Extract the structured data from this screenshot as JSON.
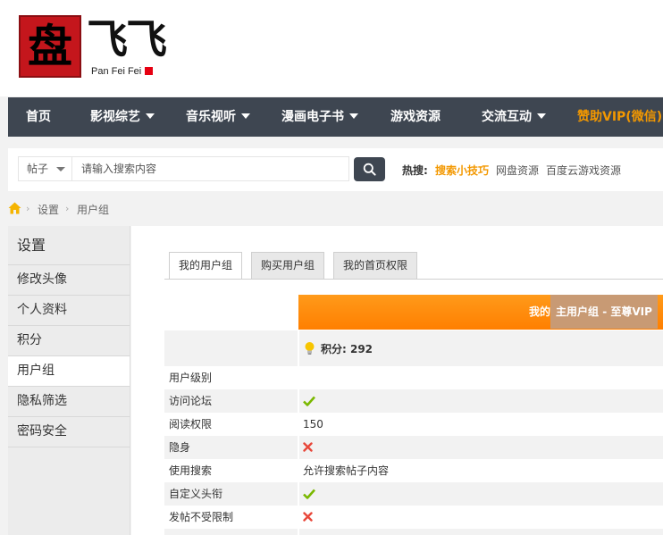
{
  "header": {
    "logo_char": "盘",
    "logo_brush": "飞飞",
    "logo_sub": "Pan Fei Fei"
  },
  "nav": {
    "items": [
      {
        "label": "首页",
        "has_dropdown": false
      },
      {
        "label": "影视综艺",
        "has_dropdown": true
      },
      {
        "label": "音乐视听",
        "has_dropdown": true
      },
      {
        "label": "漫画电子书",
        "has_dropdown": true
      },
      {
        "label": "游戏资源",
        "has_dropdown": false
      },
      {
        "label": "交流互动",
        "has_dropdown": true
      },
      {
        "label": "赞助VIP(微信)",
        "has_dropdown": false,
        "color": "#f39800"
      }
    ]
  },
  "search": {
    "type_selected": "帖子",
    "placeholder": "请输入搜索内容",
    "hot_label": "热搜:",
    "hot_links": [
      "搜索小技巧",
      "网盘资源",
      "百度云游戏资源"
    ]
  },
  "breadcrumb": {
    "items": [
      "设置",
      "用户组"
    ]
  },
  "sidebar": {
    "title": "设置",
    "items": [
      {
        "label": "修改头像",
        "active": false
      },
      {
        "label": "个人资料",
        "active": false
      },
      {
        "label": "积分",
        "active": false
      },
      {
        "label": "用户组",
        "active": true
      },
      {
        "label": "隐私筛选",
        "active": false
      },
      {
        "label": "密码安全",
        "active": false
      }
    ]
  },
  "tabs": [
    {
      "label": "我的用户组",
      "active": true
    },
    {
      "label": "购买用户组",
      "active": false
    },
    {
      "label": "我的首页权限",
      "active": false
    }
  ],
  "group": {
    "title_prefix": "我的",
    "title_current": "主用户组 - 至尊VIP",
    "points_text": "积分: 292"
  },
  "permissions": [
    {
      "label": "用户级别",
      "value": "",
      "status": "none"
    },
    {
      "label": "访问论坛",
      "value": "",
      "status": "yes"
    },
    {
      "label": "阅读权限",
      "value": "150",
      "status": "text"
    },
    {
      "label": "隐身",
      "value": "",
      "status": "no"
    },
    {
      "label": "使用搜索",
      "value": "允许搜索帖子内容",
      "status": "text"
    },
    {
      "label": "自定义头衔",
      "value": "",
      "status": "yes"
    },
    {
      "label": "发帖不受限制",
      "value": "",
      "status": "no"
    }
  ],
  "colors": {
    "nav_bg": "#3e4651",
    "accent_orange": "#f39800",
    "group_header": "#ff8a00",
    "check_green": "#7ab800",
    "cross_red": "#e8483b"
  }
}
